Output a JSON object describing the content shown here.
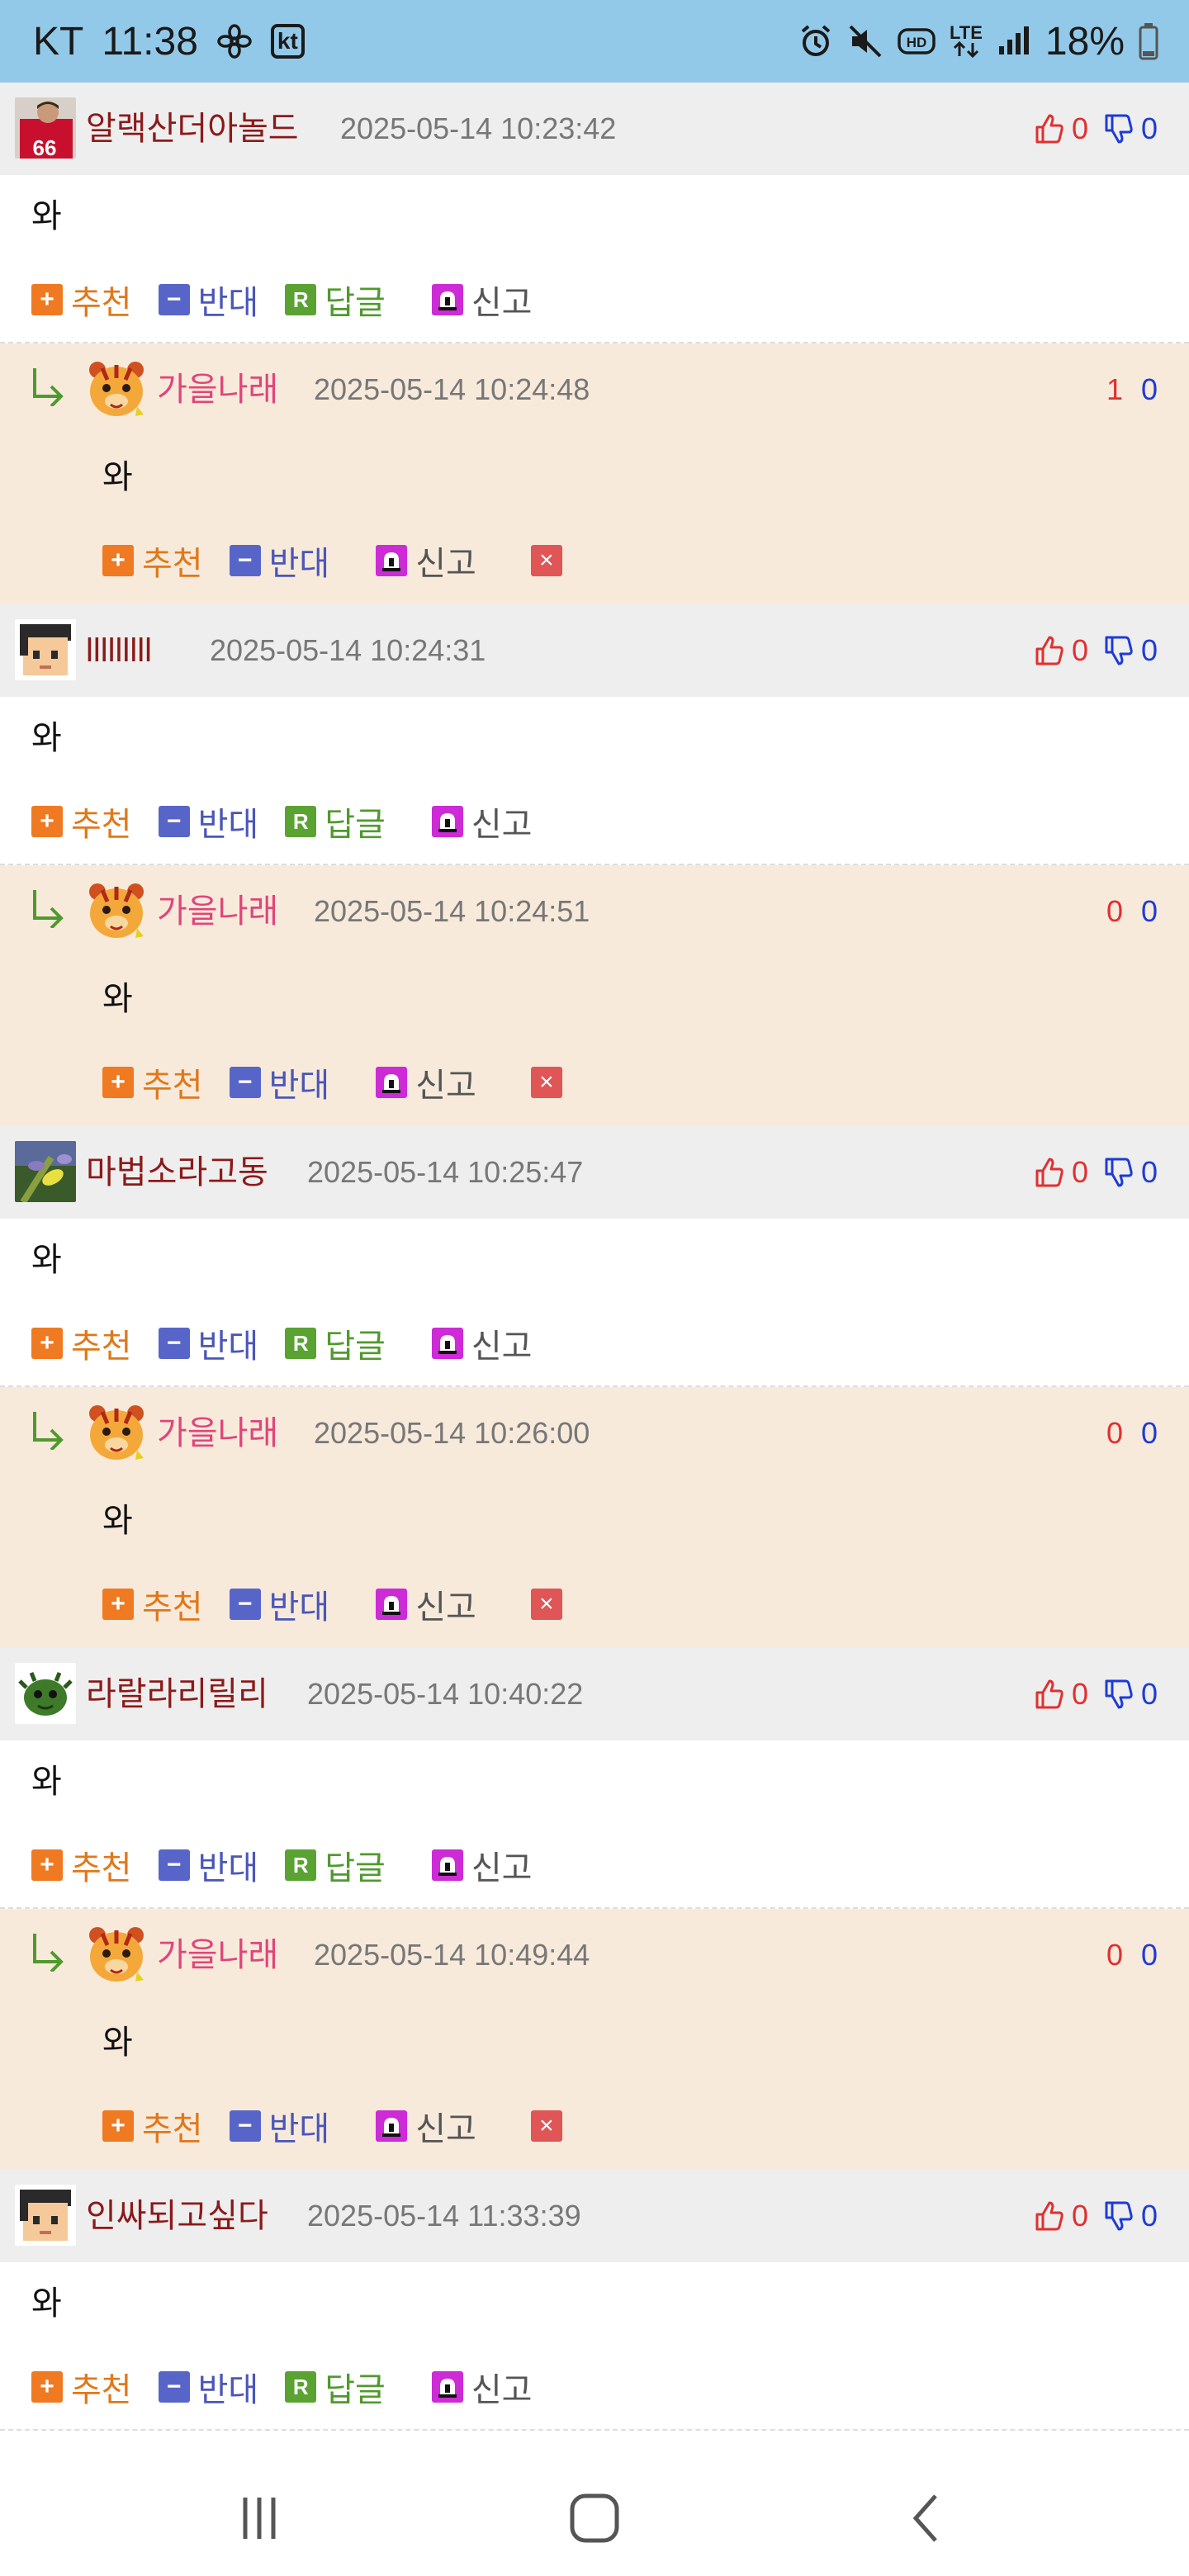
{
  "status_bar": {
    "carrier": "KT",
    "time": "11:38",
    "carrier_badge": "kt",
    "lte_label": "LTE",
    "battery": "18%"
  },
  "labels": {
    "recommend": "추천",
    "oppose": "반대",
    "reply": "답글",
    "report": "신고"
  },
  "comments": [
    {
      "type": "top",
      "nickname": "알랙산더아놀드",
      "date": "2025-05-14 10:23:42",
      "up": "0",
      "down": "0",
      "body": "와",
      "avatar": "avatar-soccer-player"
    },
    {
      "type": "reply",
      "nickname": "가을나래",
      "date": "2025-05-14 10:24:48",
      "up": "1",
      "down": "0",
      "body": "와",
      "avatar": "avatar-tiger"
    },
    {
      "type": "top",
      "nickname": "lllllllll",
      "date": "2025-05-14 10:24:31",
      "up": "0",
      "down": "0",
      "body": "와",
      "avatar": "avatar-pixel-face"
    },
    {
      "type": "reply",
      "nickname": "가을나래",
      "date": "2025-05-14 10:24:51",
      "up": "0",
      "down": "0",
      "body": "와",
      "avatar": "avatar-tiger"
    },
    {
      "type": "top",
      "nickname": "마법소라고동",
      "date": "2025-05-14 10:25:47",
      "up": "0",
      "down": "0",
      "body": "와",
      "avatar": "avatar-flower"
    },
    {
      "type": "reply",
      "nickname": "가을나래",
      "date": "2025-05-14 10:26:00",
      "up": "0",
      "down": "0",
      "body": "와",
      "avatar": "avatar-tiger"
    },
    {
      "type": "top",
      "nickname": "라랄라리릴리",
      "date": "2025-05-14 10:40:22",
      "up": "0",
      "down": "0",
      "body": "와",
      "avatar": "avatar-green-creature"
    },
    {
      "type": "reply",
      "nickname": "가을나래",
      "date": "2025-05-14 10:49:44",
      "up": "0",
      "down": "0",
      "body": "와",
      "avatar": "avatar-tiger"
    },
    {
      "type": "top",
      "nickname": "인싸되고싶다",
      "date": "2025-05-14 11:33:39",
      "up": "0",
      "down": "0",
      "body": "와",
      "avatar": "avatar-pixel-face"
    }
  ],
  "colors": {
    "status_bar_bg": "#93c9e8",
    "top_header_bg": "#eeeeee",
    "reply_bg": "#f8eadb",
    "recommend": "#ef7a22",
    "oppose": "#5865c8",
    "reply": "#5aa332",
    "report": "#cc2bd6",
    "delete": "#e05656"
  }
}
